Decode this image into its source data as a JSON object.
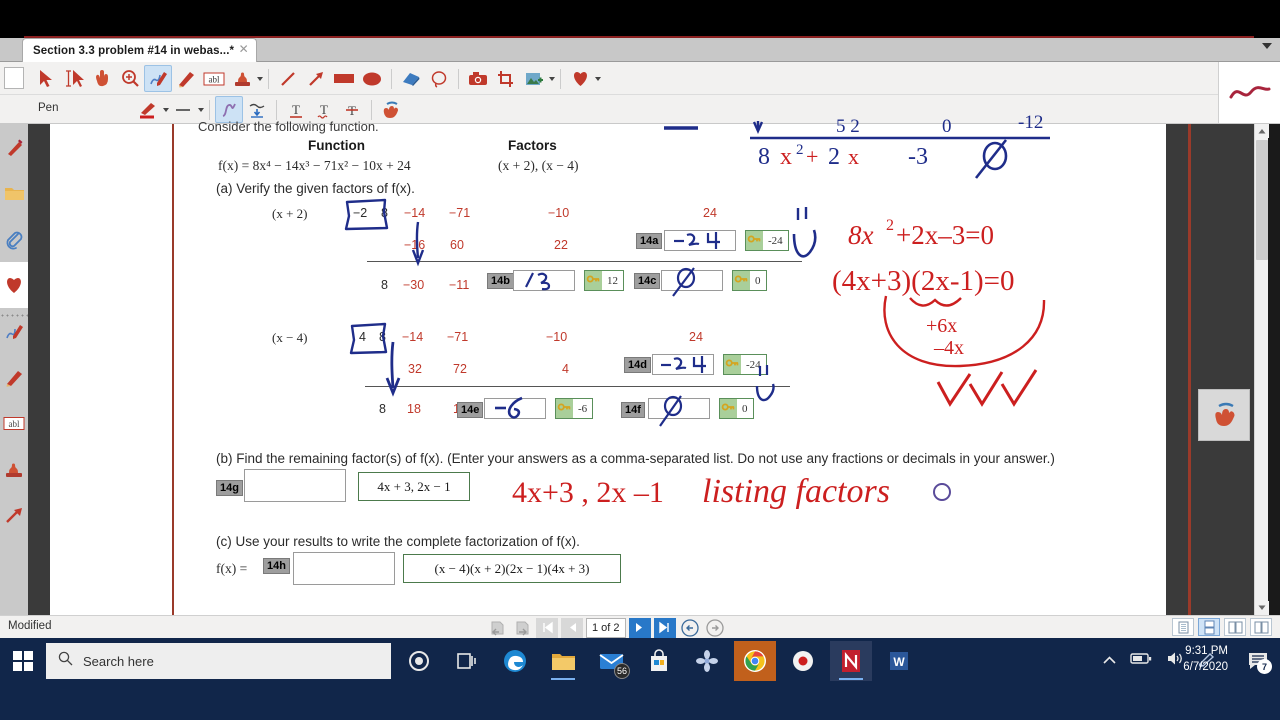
{
  "window": {
    "tab_title": "Section 3.3 problem #14 in webas...*",
    "close_icon": "close-icon",
    "overflow_caret": "chevron-down-icon"
  },
  "toolbar": {
    "pen_label": "Pen",
    "tools_row1": [
      {
        "name": "select-arrow-tool",
        "icon": "arrow-cursor-icon",
        "selected": false
      },
      {
        "name": "text-select-tool",
        "icon": "text-cursor-icon",
        "selected": false
      },
      {
        "name": "hand-pan-tool",
        "icon": "hand-icon",
        "selected": false
      },
      {
        "name": "zoom-tool",
        "icon": "magnifier-plus-icon",
        "selected": false
      },
      {
        "name": "pen-tool",
        "icon": "pen-squiggle-icon",
        "selected": true
      },
      {
        "name": "pencil-tool",
        "icon": "pencil-icon",
        "selected": false
      },
      {
        "name": "textbox-tool",
        "icon": "abl-textbox-icon",
        "selected": false
      },
      {
        "name": "stamp-tool",
        "icon": "stamp-icon",
        "selected": false
      },
      {
        "name": "line-tool",
        "icon": "line-icon",
        "selected": false
      },
      {
        "name": "arrow-tool",
        "icon": "arrow-icon",
        "selected": false
      },
      {
        "name": "rectangle-tool",
        "icon": "filled-rectangle-icon",
        "selected": false
      },
      {
        "name": "ellipse-tool",
        "icon": "filled-ellipse-icon",
        "selected": false
      },
      {
        "name": "eraser-tool",
        "icon": "eraser-icon",
        "selected": false
      },
      {
        "name": "lasso-tool",
        "icon": "lasso-icon",
        "selected": false
      },
      {
        "name": "snapshot-tool",
        "icon": "camera-icon",
        "selected": false
      },
      {
        "name": "crop-tool",
        "icon": "crop-icon",
        "selected": false
      },
      {
        "name": "image-stamp-tool",
        "icon": "image-icon",
        "selected": false
      },
      {
        "name": "favorite-tool",
        "icon": "heart-icon",
        "selected": false
      }
    ],
    "tools_row2": [
      {
        "name": "pen-color",
        "icon": "pen-color-icon"
      },
      {
        "name": "line-width",
        "icon": "line-width-icon"
      },
      {
        "name": "freehand-curve",
        "icon": "curve-icon",
        "selected": true
      },
      {
        "name": "smooth-curve",
        "icon": "smooth-curve-icon"
      },
      {
        "name": "underline-text",
        "icon": "underline-icon"
      },
      {
        "name": "squiggly-underline",
        "icon": "squiggly-underline-icon"
      },
      {
        "name": "strikethrough-text",
        "icon": "strikethrough-icon"
      },
      {
        "name": "eraser-stroke",
        "icon": "hand-eraser-icon"
      }
    ],
    "preview_icon": "red-squiggle-preview"
  },
  "sidebar": {
    "items": [
      {
        "name": "bookmark-pen",
        "icon": "red-pen-icon"
      },
      {
        "name": "folder",
        "icon": "folder-icon"
      },
      {
        "name": "attachments",
        "icon": "paperclip-icon"
      },
      {
        "name": "favorites",
        "icon": "heart-icon",
        "active": true
      },
      {
        "name": "pen-annotations",
        "icon": "pen-squiggle-icon"
      },
      {
        "name": "pencil-annotations",
        "icon": "pencil-icon"
      },
      {
        "name": "textbox-annotations",
        "icon": "abl-textbox-icon"
      },
      {
        "name": "stamp-annotations",
        "icon": "stamp-icon"
      },
      {
        "name": "arrow-annotations",
        "icon": "arrow-icon"
      }
    ]
  },
  "document": {
    "partial_heading": "Consider the following function.",
    "col_function": "Function",
    "col_factors": "Factors",
    "function_expr": "f(x) = 8x⁴ − 14x³ − 71x² − 10x + 24",
    "factors_expr": "(x + 2), (x − 4)",
    "part_a": "(a) Verify the given factors of  f(x).",
    "div1": {
      "factor_label": "(x + 2)",
      "divisor": "−2",
      "row1": [
        "8",
        "−14",
        "−71",
        "−10",
        "24"
      ],
      "row2": [
        "−16",
        "60",
        "22"
      ],
      "row3": [
        "8",
        "−30",
        "−11"
      ],
      "fields": [
        {
          "tag": "14a",
          "handwritten": "−24",
          "key_value": "-24"
        },
        {
          "tag": "14b",
          "handwritten": "12",
          "key_value": "12"
        },
        {
          "tag": "14c",
          "handwritten": "0",
          "key_value": "0"
        }
      ]
    },
    "div2": {
      "factor_label": "(x − 4)",
      "divisor": "4",
      "row1": [
        "8",
        "−14",
        "−71",
        "−10",
        "24"
      ],
      "row2": [
        "32",
        "72",
        "4"
      ],
      "row3": [
        "8",
        "18",
        "1"
      ],
      "fields": [
        {
          "tag": "14d",
          "handwritten": "−24",
          "key_value": "-24"
        },
        {
          "tag": "14e",
          "handwritten": "−6",
          "key_value": "-6"
        },
        {
          "tag": "14f",
          "handwritten": "0",
          "key_value": "0"
        }
      ]
    },
    "part_b": "(b) Find the remaining factor(s) of  f(x).  (Enter your answers as a comma-separated list. Do not use any fractions or decimals in your answer.)",
    "part_b_tag": "14g",
    "part_b_input": "",
    "part_b_answer": "4x + 3, 2x − 1",
    "part_c": "(c) Use your results to write the complete factorization of  f(x).",
    "part_c_prefix": "f(x) =",
    "part_c_tag": "14h",
    "part_c_input": "",
    "part_c_answer": "(x − 4)(x + 2)(2x − 1)(4x + 3)"
  },
  "annotations": {
    "blue_top_line": "8x² + 2x  −3   0",
    "red_eq1": "8x²+2x−3=0",
    "red_eq2": "(4x+3)(2x−1)=0",
    "red_note_plus": "+6x",
    "red_note_minus": "−4x",
    "red_label_listing": "listing factors",
    "red_factors_hw": "4x+3 ,  2x −1",
    "checkmark_color": "#c0392b",
    "blue_ink": "#1f2d8a",
    "red_ink": "#cc1f1f"
  },
  "statusbar": {
    "status": "Modified",
    "prev_page_nav": "first-page-icon",
    "page_indicator": "1 of 2",
    "buttons": [
      "rotate-left-icon",
      "rotate-right-icon",
      "first-page-icon",
      "prev-page-icon",
      "next-page-icon",
      "last-page-icon",
      "back-icon",
      "forward-icon"
    ],
    "view_modes": [
      "single-page-view",
      "continuous-view",
      "facing-view",
      "book-view"
    ],
    "active_view_mode": 1
  },
  "taskbar": {
    "start_icon": "windows-start-icon",
    "search_placeholder": "Search here",
    "search_icon": "search-icon",
    "apps": [
      {
        "name": "cortana",
        "icon": "cortana-circle-icon"
      },
      {
        "name": "task-view",
        "icon": "task-view-icon"
      },
      {
        "name": "edge",
        "icon": "edge-icon"
      },
      {
        "name": "file-explorer",
        "icon": "folder-icon"
      },
      {
        "name": "mail",
        "icon": "mail-icon",
        "badge": "56"
      },
      {
        "name": "microsoft-store",
        "icon": "store-icon"
      },
      {
        "name": "photos",
        "icon": "photos-icon"
      },
      {
        "name": "chrome",
        "icon": "chrome-icon"
      },
      {
        "name": "screen-recorder",
        "icon": "record-icon"
      },
      {
        "name": "nitro-pdf",
        "icon": "nitro-icon"
      },
      {
        "name": "word",
        "icon": "word-icon"
      }
    ],
    "tray": [
      "show-hidden-icons-caret",
      "battery-icon",
      "volume-icon",
      "pen-icon"
    ],
    "time": "9:31 PM",
    "date": "6/7/2020",
    "notification_count": "7"
  }
}
